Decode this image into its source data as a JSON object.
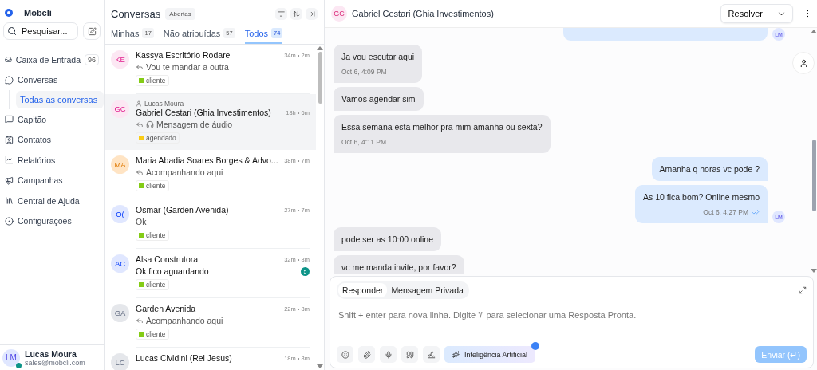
{
  "brand": {
    "name": "Mobcli"
  },
  "search": {
    "placeholder": "Pesquisar..."
  },
  "nav": [
    {
      "label": "Caixa de Entrada",
      "count": "96",
      "selected": false
    },
    {
      "label": "Conversas",
      "selected": false,
      "expanded": true,
      "children": [
        {
          "label": "Todas as conversas",
          "selected": true
        }
      ]
    },
    {
      "label": "Capitão",
      "selected": false
    },
    {
      "label": "Contatos",
      "selected": false
    },
    {
      "label": "Relatórios",
      "selected": false
    },
    {
      "label": "Campanhas",
      "selected": false
    },
    {
      "label": "Central de Ajuda",
      "selected": false
    },
    {
      "label": "Configurações",
      "selected": false
    }
  ],
  "user": {
    "initials": "LM",
    "name": "Lucas Moura",
    "email": "sales@mobcli.com",
    "online": true
  },
  "list": {
    "title": "Conversas",
    "status": "Abertas",
    "tabs": [
      {
        "label": "Minhas",
        "count": "17",
        "selected": false
      },
      {
        "label": "Não atribuídas",
        "count": "57",
        "selected": false
      },
      {
        "label": "Todos",
        "count": "74",
        "selected": true
      }
    ],
    "conversations": [
      {
        "initials": "KE",
        "color": "#fce7f3",
        "name": "Kassya Escritório Rodare",
        "time": "34m • 2m",
        "replied": true,
        "preview": "Vou te mandar a outra",
        "tag": {
          "label": "cliente",
          "color": "#84cc16"
        },
        "selected": false
      },
      {
        "initials": "GC",
        "color": "#fce7f3",
        "assignee": "Lucas Moura",
        "name": "Gabriel Cestari (Ghia Investimentos)",
        "time": "18h • 6m",
        "replied": true,
        "audio": true,
        "preview": "Mensagem de áudio",
        "tag": {
          "label": "agendado",
          "color": "#facc15"
        },
        "selected": true
      },
      {
        "initials": "MA",
        "color": "#ffe4c4",
        "name": "Maria Abadia Soares Borges & Advo...",
        "time": "38m • 7m",
        "replied": true,
        "preview": "Acompanhando aqui",
        "tag": {
          "label": "cliente",
          "color": "#84cc16"
        },
        "selected": false
      },
      {
        "initials": "O(",
        "color": "#e0e7ff",
        "name": "Osmar (Garden Avenida)",
        "time": "27m • 7m",
        "replied": false,
        "preview": "Ok",
        "tag": {
          "label": "cliente",
          "color": "#84cc16"
        },
        "selected": false
      },
      {
        "initials": "AC",
        "color": "#e0e7ff",
        "name": "Alsa Construtora",
        "time": "32m • 8m",
        "replied": false,
        "unread": "5",
        "preview": "Ok fico aguardando",
        "tag": {
          "label": "cliente",
          "color": "#84cc16"
        },
        "selected": false
      },
      {
        "initials": "GA",
        "color": "#e5e7eb",
        "name": "Garden Avenida",
        "time": "22m • 8m",
        "replied": true,
        "preview": "Acompanhando aqui",
        "tag": {
          "label": "cliente",
          "color": "#84cc16"
        },
        "selected": false
      },
      {
        "initials": "LC",
        "color": "#e5e7eb",
        "name": "Lucas Cividini (Rei Jesus)",
        "time": "18m • 8m",
        "selected": false
      }
    ]
  },
  "chat": {
    "initials": "GC",
    "title": "Gabriel Cestari (Ghia Investimentos)",
    "action": "Resolver",
    "partial_message": {
      "avatar": "LM"
    },
    "messages": [
      {
        "kind": "incoming",
        "text": "Ja vou escutar aqui",
        "time": "Oct 6, 4:09 PM"
      },
      {
        "kind": "incoming",
        "text": "Vamos agendar sim"
      },
      {
        "kind": "incoming",
        "text": "Essa semana esta melhor pra mim amanha ou sexta?",
        "time": "Oct 6, 4:11 PM"
      },
      {
        "kind": "outgoing",
        "text": "Amanha q horas vc pode ?"
      },
      {
        "kind": "outgoing",
        "text": "As 10 fica bom? Online mesmo",
        "time": "Oct 6, 4:27 PM",
        "avatar": "LM",
        "read": true
      },
      {
        "kind": "incoming",
        "text": "pode ser as 10:00 online"
      },
      {
        "kind": "incoming",
        "text": "vc me manda invite, por favor?"
      }
    ],
    "composer": {
      "modes": [
        {
          "label": "Responder",
          "selected": true
        },
        {
          "label": "Mensagem Privada",
          "selected": false
        }
      ],
      "placeholder": "Shift + enter para nova linha. Digite '/' para selecionar uma Resposta Pronta.",
      "ai_label": "Inteligência Artificial",
      "ai_notice": true,
      "send": "Enviar (↵)",
      "send_disabled": true
    }
  }
}
